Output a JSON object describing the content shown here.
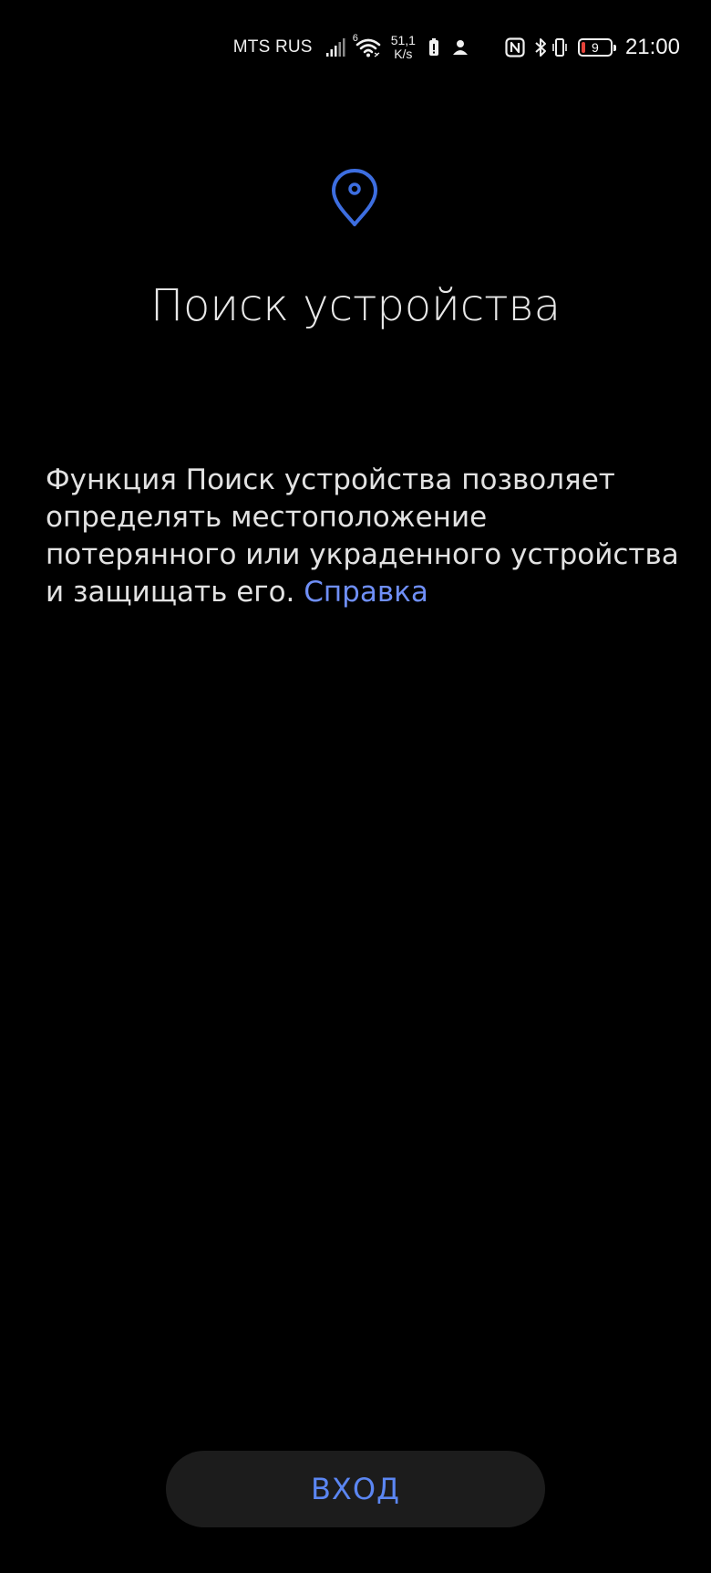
{
  "status_bar": {
    "carrier": "MTS RUS",
    "network_type": "6",
    "speed_value": "51,1",
    "speed_unit": "K/s",
    "battery_level": "9",
    "time": "21:00",
    "icons": [
      "signal-icon",
      "wifi-icon",
      "battery-saver-icon",
      "person-icon",
      "nfc-icon",
      "bluetooth-icon",
      "vibrate-icon",
      "battery-icon"
    ]
  },
  "main": {
    "icon": "location-pin-icon",
    "title": "Поиск устройства",
    "description": "Функция Поиск устройства позволяет определять местоположение потерянного или украденного устройства и защищать его.",
    "help_link": "Справка"
  },
  "footer": {
    "login_label": "ВХОД"
  },
  "colors": {
    "background": "#000000",
    "accent": "#5b86f2",
    "link": "#6f8ff7",
    "button_bg": "#1c1c1c",
    "battery_low": "#e5433a"
  }
}
